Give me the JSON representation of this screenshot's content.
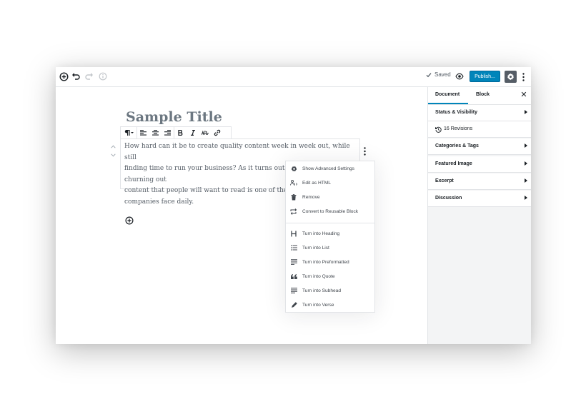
{
  "topbar": {
    "saved_label": "Saved",
    "publish_label": "Publish..."
  },
  "editor": {
    "title": "Sample Title",
    "paragraph_lines": [
      "How hard can it be to create quality content week in week out, while still",
      "finding time to run your business? As it turns out, consistently churning out",
      "content that people will want to read is one of the biggest",
      "companies face daily."
    ]
  },
  "block_menu": {
    "items": [
      {
        "label": "Show Advanced Settings",
        "icon": "gear-icon"
      },
      {
        "label": "Edit as HTML",
        "icon": "html-icon"
      },
      {
        "label": "Remove",
        "icon": "trash-icon"
      },
      {
        "label": "Convert to Reusable Block",
        "icon": "reusable-block-icon"
      }
    ],
    "transforms": [
      {
        "label": "Turn into Heading",
        "icon": "heading-icon"
      },
      {
        "label": "Turn into List",
        "icon": "list-icon"
      },
      {
        "label": "Turn into Preformatted",
        "icon": "preformatted-icon"
      },
      {
        "label": "Turn into Quote",
        "icon": "quote-icon"
      },
      {
        "label": "Turn into Subhead",
        "icon": "subhead-icon"
      },
      {
        "label": "Turn into Verse",
        "icon": "verse-icon"
      }
    ]
  },
  "sidebar": {
    "tabs": [
      "Document",
      "Block"
    ],
    "active_tab": "Document",
    "panels": [
      {
        "label": "Status & Visibility"
      },
      {
        "label": "16 Revisions"
      },
      {
        "label": "Categories & Tags"
      },
      {
        "label": "Featured Image"
      },
      {
        "label": "Excerpt"
      },
      {
        "label": "Discussion"
      }
    ]
  },
  "colors": {
    "accent": "#0085ba",
    "settings_bg": "#555d66",
    "sidebar_bg": "#f3f4f5"
  }
}
